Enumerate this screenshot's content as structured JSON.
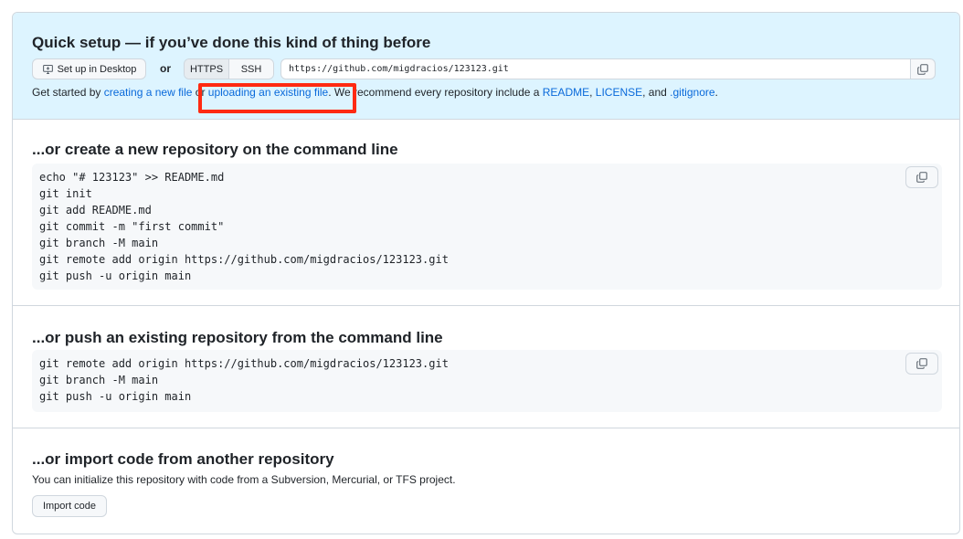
{
  "quick_setup": {
    "title": "Quick setup — if you’ve done this kind of thing before",
    "desktop_button": "Set up in Desktop",
    "or": "or",
    "protocols": [
      "HTTPS",
      "SSH"
    ],
    "url": "https://github.com/migdracios/123123.git",
    "get_started": {
      "prefix": "Get started by ",
      "link_create": "creating a new file",
      "mid": " or ",
      "link_upload": "uploading an existing file",
      "suffix": ". We recommend every repository include a ",
      "link_readme": "README",
      "sep1": ", ",
      "link_license": "LICENSE",
      "sep2": ", and ",
      "link_gitignore": ".gitignore",
      "end": "."
    }
  },
  "create_section": {
    "title": "...or create a new repository on the command line",
    "code": [
      "echo \"# 123123\" >> README.md",
      "git init",
      "git add README.md",
      "git commit -m \"first commit\"",
      "git branch -M main",
      "git remote add origin https://github.com/migdracios/123123.git",
      "git push -u origin main"
    ]
  },
  "push_section": {
    "title": "...or push an existing repository from the command line",
    "code": [
      "git remote add origin https://github.com/migdracios/123123.git",
      "git branch -M main",
      "git push -u origin main"
    ]
  },
  "import_section": {
    "title": "...or import code from another repository",
    "description": "You can initialize this repository with code from a Subversion, Mercurial, or TFS project.",
    "button": "Import code"
  },
  "colors": {
    "accent_link": "#0969da",
    "setup_bg": "#ddf4ff",
    "annotation_red": "#ff2a12"
  },
  "icons": [
    "desktop-icon",
    "copy-icon"
  ]
}
